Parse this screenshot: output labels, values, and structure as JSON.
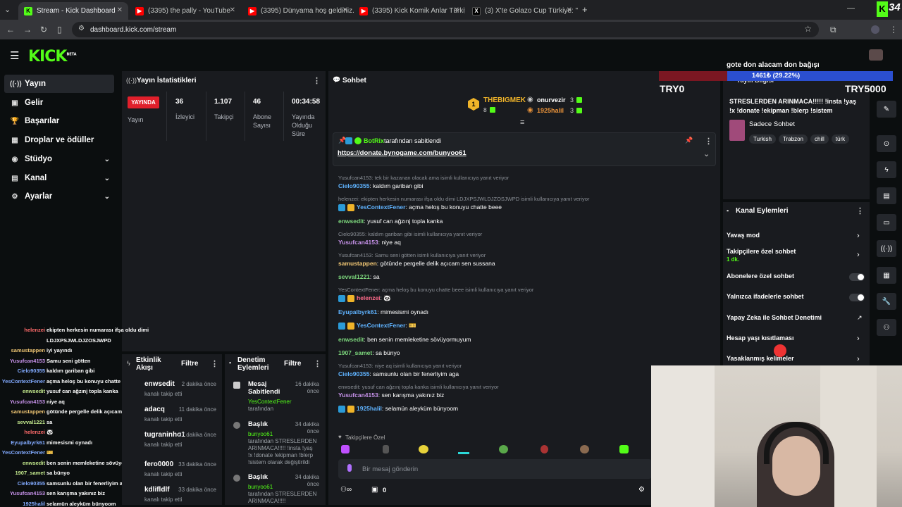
{
  "browser": {
    "tabs": [
      {
        "title": "Stream - Kick Dashboard",
        "active": true
      },
      {
        "title": "(3395) the pally - YouTube",
        "active": false
      },
      {
        "title": "(3395) Dünyama hoş geldiniz...",
        "active": false
      },
      {
        "title": "(3395) Kick Komik Anlar Türkiye",
        "active": false
      },
      {
        "title": "(3) X'te Golazo Cup Türkiye: \"8...",
        "active": false
      }
    ],
    "url": "dashboard.kick.com/stream"
  },
  "header": {
    "logo": "KICK",
    "logo_sup": "BETA"
  },
  "sidebar": {
    "items": [
      {
        "label": "Yayın",
        "icon": "broadcast-icon",
        "selected": true,
        "chevron": false
      },
      {
        "label": "Gelir",
        "icon": "money-icon",
        "selected": false,
        "chevron": false
      },
      {
        "label": "Başarılar",
        "icon": "trophy-icon",
        "selected": false,
        "chevron": false
      },
      {
        "label": "Droplar ve ödüller",
        "icon": "gift-icon",
        "selected": false,
        "chevron": false
      },
      {
        "label": "Stüdyo",
        "icon": "studio-icon",
        "selected": false,
        "chevron": true
      },
      {
        "label": "Kanal",
        "icon": "channel-icon",
        "selected": false,
        "chevron": true
      },
      {
        "label": "Ayarlar",
        "icon": "gear-icon",
        "selected": false,
        "chevron": true
      }
    ]
  },
  "stats": {
    "title": "Yayın İstatistikleri",
    "live_badge": "YAYINDA",
    "live_label": "Yayın",
    "items": [
      {
        "value": "36",
        "label": "İzleyici"
      },
      {
        "value": "1.107",
        "label": "Takipçi"
      },
      {
        "value": "46",
        "label": "Abone Sayısı"
      },
      {
        "value": "00:34:58",
        "label": "Yayında Olduğu Süre"
      }
    ]
  },
  "overlay": {
    "donation_title": "gote don alacam don bağışı",
    "goal_text": "1461₺ (29.22%)",
    "goal_progress": 0.2922,
    "goal_min": "TRY0",
    "goal_max": "TRY5000",
    "chat": [
      {
        "user": "helenzei",
        "text": "ekipten herkesin numarası ifşa oldu dimi",
        "color": "#ff6b6b"
      },
      {
        "user": "",
        "text": "LDJXPSJWLDJZOSJWPD",
        "color": "#fff"
      },
      {
        "user": "samustappen",
        "text": "iyi yayındı",
        "color": "#f0c674"
      },
      {
        "user": "Yusufcan4153",
        "text": "Samu seni götten",
        "color": "#c792ea"
      },
      {
        "user": "Cielo90355",
        "text": "kaldım gariban gibi",
        "color": "#82aaff"
      },
      {
        "user": "YesContextFener",
        "text": "açma heloş bu konuyu chatte beee",
        "color": "#82aaff"
      },
      {
        "user": "enwsedit",
        "text": "yusuf can ağzınj topla kanka",
        "color": "#c3e88d"
      },
      {
        "user": "Yusufcan4153",
        "text": "niye aq",
        "color": "#c792ea"
      },
      {
        "user": "samustappen",
        "text": "götünde pergelle delik açıcam sen sussana",
        "color": "#f0c674"
      },
      {
        "user": "sevval1221",
        "text": "sa",
        "color": "#c3e88d"
      },
      {
        "user": "helenzei",
        "text": "🐼",
        "color": "#ff6b6b"
      },
      {
        "user": "Eyupalbyrk61",
        "text": "mimesismi oynadı",
        "color": "#82aaff"
      },
      {
        "user": "YesContextFener",
        "text": "🎫",
        "color": "#82aaff"
      },
      {
        "user": "enwsedit",
        "text": "ben senin memleketine sövüyormuyum",
        "color": "#c3e88d"
      },
      {
        "user": "1907_samet",
        "text": "sa bünyo",
        "color": "#c3e88d"
      },
      {
        "user": "Cielo90355",
        "text": "samsunlu olan bir fenerliyim aga",
        "color": "#82aaff"
      },
      {
        "user": "Yusufcan4153",
        "text": "sen karışma yakınız biz",
        "color": "#c792ea"
      },
      {
        "user": "1925halil",
        "text": "selamün aleyküm bünyoom",
        "color": "#82aaff"
      }
    ]
  },
  "activity": {
    "title": "Etkinlik Akışı",
    "filter": "Filtre",
    "items": [
      {
        "name": "enwsedit",
        "time": "2 dakika önce",
        "sub": "kanalı takip etti"
      },
      {
        "name": "adacq",
        "time": "11 dakika önce",
        "sub": "kanalı takip etti"
      },
      {
        "name": "tugraninho1",
        "time": "27 dakika önce",
        "sub": "kanalı takip etti"
      },
      {
        "name": "fero0000",
        "time": "33 dakika önce",
        "sub": "kanalı takip etti"
      },
      {
        "name": "kdlifldlf",
        "time": "33 dakika önce",
        "sub": "kanalı takip etti"
      }
    ]
  },
  "moderation": {
    "title": "Denetim Eylemleri",
    "filter": "Filtre",
    "items": [
      {
        "title": "Mesaj Sabitlendi",
        "time": "16 dakika önce",
        "user": "YesContextFener",
        "detail": "tarafından"
      },
      {
        "title": "Başlık",
        "time": "34 dakika önce",
        "user": "bunyoo61",
        "detail": "tarafından STRESLERDEN ARINMACA!!!!! !insta !yaş !x !donate !ekipman !blerp !sistem olarak değiştirildi"
      },
      {
        "title": "Başlık",
        "time": "34 dakika önce",
        "user": "bunyoo61",
        "detail": "tarafından STRESLERDEN ARINMACA!!!!!"
      }
    ]
  },
  "chat": {
    "title": "Sohbet",
    "leaderboard": [
      {
        "rank": "1",
        "name": "THEBIGMEK",
        "count": "8"
      },
      {
        "rank": "",
        "name": "onurvezir",
        "count": "3"
      },
      {
        "rank": "",
        "name": "1925halil",
        "count": "3"
      }
    ],
    "pinned": {
      "by": "BotRix",
      "by_suffix": "tarafından sabitlendi",
      "link": "https://donate.bynogame.com/bunyoo61"
    },
    "messages": [
      {
        "reply": "Yusufcan4153: tek bir kazanan olacak ama isimli kullanıcıya yanıt veriyor",
        "user": "Cielo90355",
        "text": "kaldım gariban gibi",
        "color": "#5fb3ff"
      },
      {
        "reply": "helenzei: ekipten herkesin numarası ifşa oldu dimi LDJXPSJWLDJZOSJWPD isimli kullanıcıya yanıt veriyor",
        "user": "YesContextFener",
        "text": "açma heloş bu konuyu chatte beee",
        "color": "#5fb3ff"
      },
      {
        "reply": "",
        "user": "enwsedit",
        "text": "yusuf can ağzınj topla kanka",
        "color": "#7dd87d"
      },
      {
        "reply": "Cielo90355: kaldım gariban gibi isimli kullanıcıya yanıt veriyor",
        "user": "Yusufcan4153",
        "text": "niye aq",
        "color": "#c792ea"
      },
      {
        "reply": "Yusufcan4153: Samu seni götten isimli kullanıcıya yanıt veriyor",
        "user": "samustappen",
        "text": "götünde pergelle delik açıcam sen sussana",
        "color": "#f0c674"
      },
      {
        "reply": "",
        "user": "sevval1221",
        "text": "sa",
        "color": "#7dd87d"
      },
      {
        "reply": "YesContextFener: açma heloş bu konuyu chatte beee isimli kullanıcıya yanıt veriyor",
        "user": "helenzei",
        "text": "🐼",
        "color": "#ff6b8a"
      },
      {
        "reply": "",
        "user": "Eyupalbyrk61",
        "text": "mimesismi oynadı",
        "color": "#5fb3ff"
      },
      {
        "reply": "",
        "user": "YesContextFener",
        "text": "🎫",
        "color": "#5fb3ff"
      },
      {
        "reply": "",
        "user": "enwsedit",
        "text": "ben senin memleketine sövüyormuyum",
        "color": "#7dd87d"
      },
      {
        "reply": "",
        "user": "1907_samet",
        "text": "sa bünyo",
        "color": "#7dd87d"
      },
      {
        "reply": "Yusufcan4153: niye aq isimli kullanıcıya yanıt veriyor",
        "user": "Cielo90355",
        "text": "samsunlu olan bir fenerliyim aga",
        "color": "#5fb3ff"
      },
      {
        "reply": "enwsedit: yusuf can ağzınj topla kanka isimli kullanıcıya yanıt veriyor",
        "user": "Yusufcan4153",
        "text": "sen karışma yakınız biz",
        "color": "#c792ea"
      },
      {
        "reply": "",
        "user": "1925halil",
        "text": "selamün aleyküm bünyoom",
        "color": "#5fb3ff"
      }
    ],
    "emote_bar_label": "Takipçilere Özel",
    "input_placeholder": "Bir mesaj gönderin",
    "footer_count": "0"
  },
  "stream_info": {
    "title_partial": "Yayın Bilgisi",
    "stream_title": "STRESLERDEN ARINMACA!!!!! !insta !yaş !x !donate !ekipman !blerp !sistem",
    "category": "Sadece Sohbet",
    "tags": [
      "Turkish",
      "Trabzon",
      "chill",
      "türk"
    ]
  },
  "channel_actions": {
    "title": "Kanal Eylemleri",
    "items": [
      {
        "label": "Yavaş mod",
        "sub": "",
        "control": "arrow"
      },
      {
        "label": "Takipçilere özel sohbet",
        "sub": "1 dk.",
        "control": "arrow"
      },
      {
        "label": "Abonelere özel sohbet",
        "sub": "",
        "control": "toggle"
      },
      {
        "label": "Yalnızca ifadelerle sohbet",
        "sub": "",
        "control": "toggle"
      },
      {
        "label": "Yapay Zeka ile Sohbet Denetimi",
        "sub": "",
        "control": "external"
      },
      {
        "label": "Hesap yaşı kısıtlaması",
        "sub": "",
        "control": "arrow"
      },
      {
        "label": "Yasaklanmış kelimeler",
        "sub": "",
        "control": "arrow"
      }
    ]
  },
  "colors": {
    "accent": "#53fc18",
    "panel": "#191b1f",
    "live": "#e01f2b"
  }
}
